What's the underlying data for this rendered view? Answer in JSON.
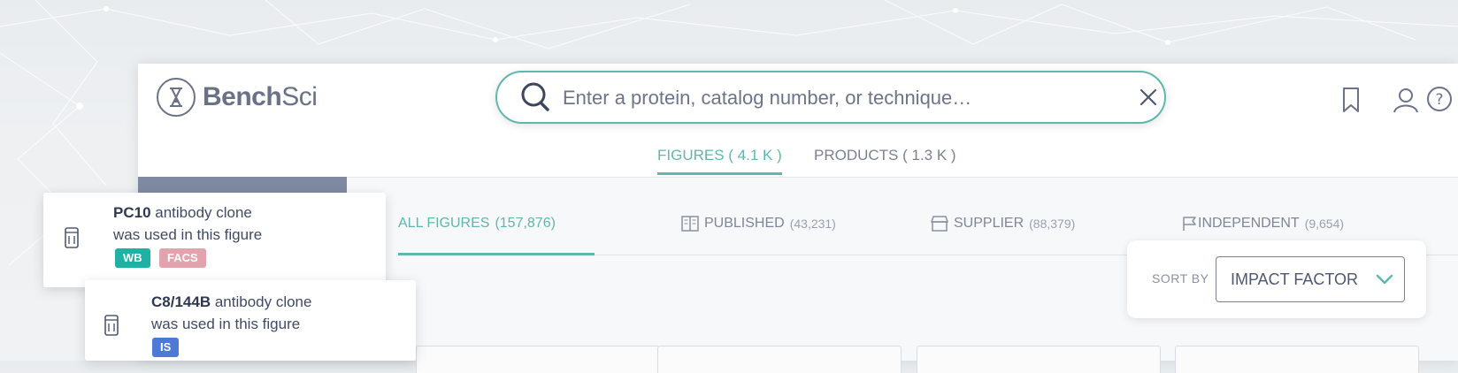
{
  "logo": {
    "bold": "Bench",
    "light": "Sci"
  },
  "search": {
    "placeholder": "Enter a protein, catalog number, or technique…"
  },
  "main_tabs": [
    {
      "label": "FIGURES ( 4.1 K )",
      "active": true
    },
    {
      "label": "PRODUCTS ( 1.3 K )",
      "active": false
    }
  ],
  "sub_tabs": [
    {
      "label": "ALL FIGURES",
      "count": "(157,876)",
      "active": true
    },
    {
      "label": "PUBLISHED",
      "count": "(43,231)",
      "icon": "book-icon"
    },
    {
      "label": "SUPPLIER",
      "count": "(88,379)",
      "icon": "store-icon"
    },
    {
      "label": "INDEPENDENT",
      "count": "(9,654)",
      "icon": "flag-icon"
    }
  ],
  "sort": {
    "label": "SORT BY",
    "value": "IMPACT FACTOR"
  },
  "tooltips": [
    {
      "clone": "PC10",
      "line1_rest": " antibody clone",
      "line2": "was used in this figure",
      "badges": [
        {
          "text": "WB",
          "color": "#1fb1a4"
        },
        {
          "text": "FACS",
          "color": "#e3a3ad"
        }
      ]
    },
    {
      "clone": "C8/144B",
      "line1_rest": " antibody clone",
      "line2": "was used in this figure",
      "badges": [
        {
          "text": "IS",
          "color": "#4f79d6"
        }
      ]
    }
  ],
  "colors": {
    "accent": "#5fb7ad",
    "text": "#55607a"
  }
}
